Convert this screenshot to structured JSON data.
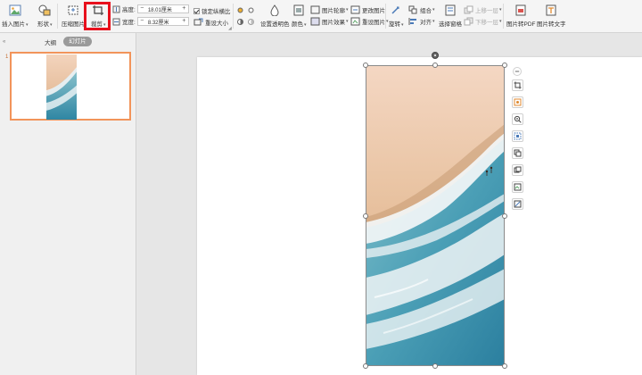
{
  "ribbon": {
    "insert_picture": "插入图片",
    "shape": "形状",
    "compress": "压缩图片",
    "crop": "裁剪",
    "height_label": "高度:",
    "height_value": "18.01厘米",
    "width_label": "宽度:",
    "width_value": "8.32厘米",
    "lock_ratio": "锁定纵横比",
    "reset_size": "重设大小",
    "set_transparent": "设置透明色",
    "color": "颜色",
    "picture_outline": "图片轮廓",
    "picture_effects": "图片效果",
    "change_picture": "更改图片",
    "reset_picture": "重设图片",
    "rotate": "旋转",
    "group": "组合",
    "align": "对齐",
    "bring_forward": "上移一层",
    "send_backward": "下移一层",
    "selection_pane": "选择窗格",
    "pic_to_pdf": "图片转PDF",
    "pic_to_text": "图片转文字"
  },
  "panel": {
    "tab_outline": "大纲",
    "tab_slides": "幻灯片",
    "slide_number": "1"
  },
  "colors": {
    "highlight": "#e8101c",
    "thumb_border": "#f2945a",
    "sand": "#e9c6a4",
    "sea": "#3b90a8"
  },
  "floating_toolbar": [
    "collapse-icon",
    "crop-icon",
    "picture-effect-icon",
    "zoom-icon",
    "cutout-icon",
    "replace-icon",
    "copy-icon",
    "layers-icon",
    "edit-icon"
  ]
}
